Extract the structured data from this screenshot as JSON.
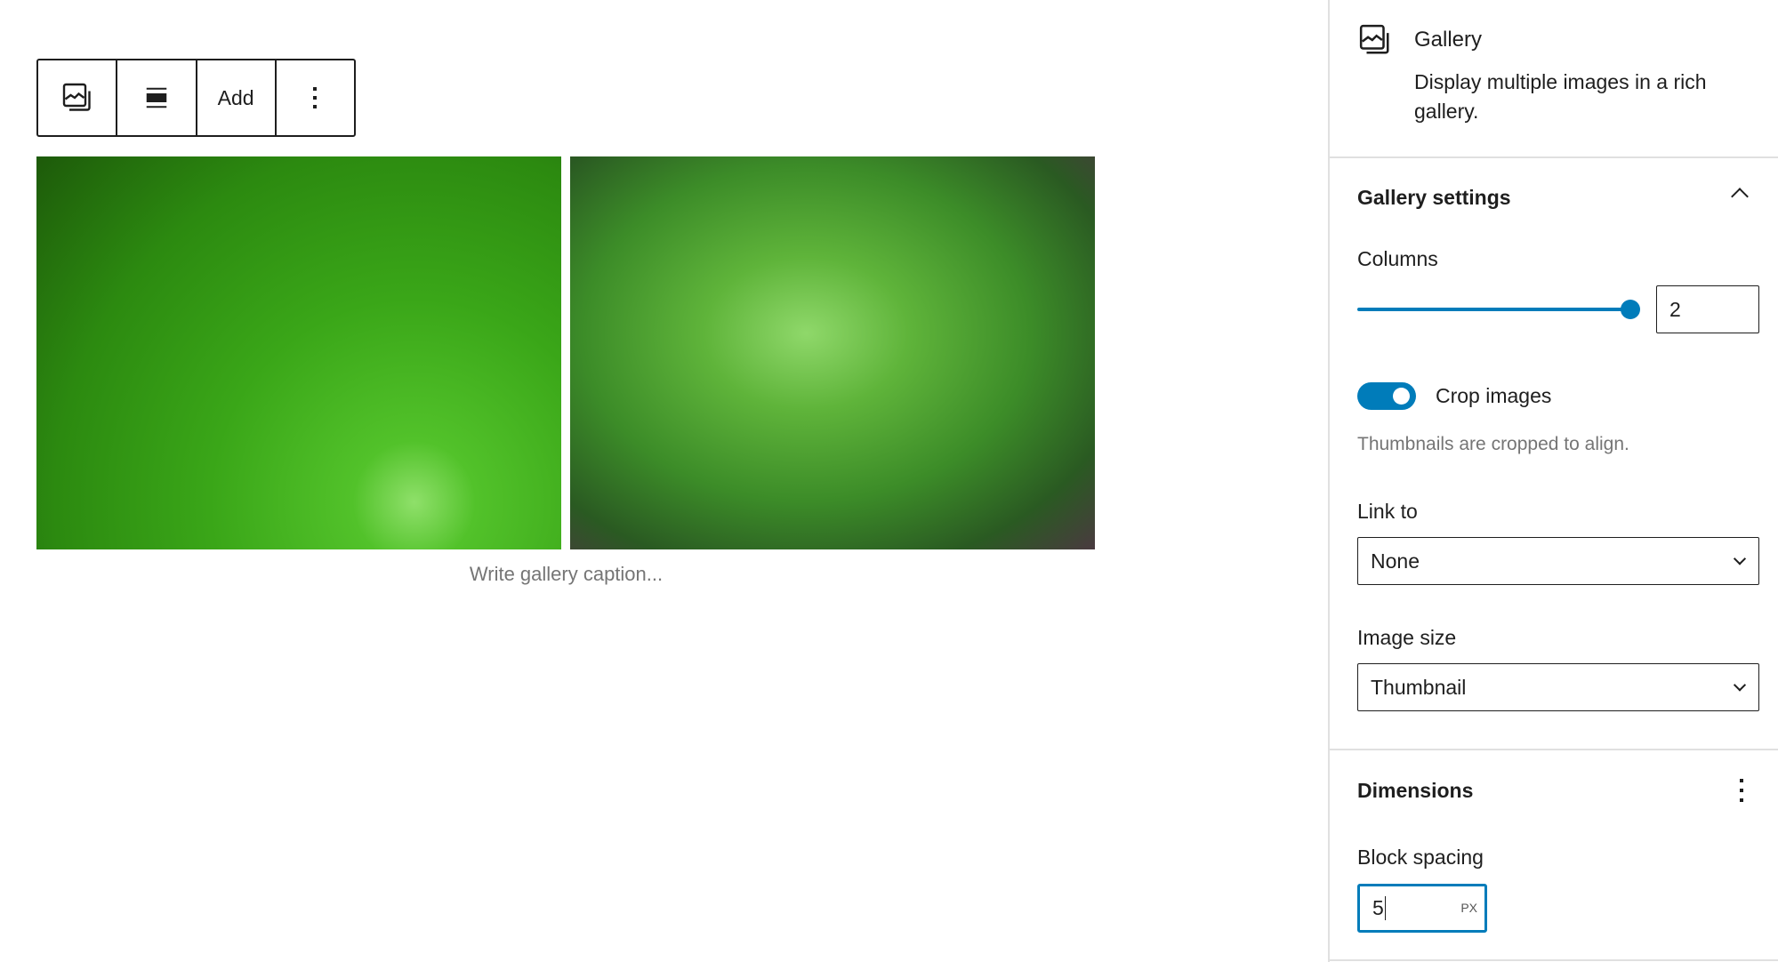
{
  "toolbar": {
    "block_icon": "gallery-icon",
    "align_icon": "align-wide-icon",
    "add_label": "Add",
    "more_icon": "more-vertical-icon"
  },
  "gallery": {
    "images": [
      "green leaf with water droplets",
      "green fern frond"
    ],
    "caption_placeholder": "Write gallery caption..."
  },
  "sidebar": {
    "block": {
      "title": "Gallery",
      "description": "Display multiple images in a rich gallery."
    },
    "gallery_settings": {
      "title": "Gallery settings",
      "columns_label": "Columns",
      "columns_value": "2",
      "columns_slider_fraction": 1.0,
      "crop_label": "Crop images",
      "crop_enabled": true,
      "crop_help": "Thumbnails are cropped to align.",
      "link_to_label": "Link to",
      "link_to_value": "None",
      "image_size_label": "Image size",
      "image_size_value": "Thumbnail"
    },
    "dimensions": {
      "title": "Dimensions",
      "block_spacing_label": "Block spacing",
      "block_spacing_value": "5",
      "block_spacing_unit": "PX"
    }
  },
  "colors": {
    "accent": "#007cba",
    "text": "#1e1e1e"
  }
}
